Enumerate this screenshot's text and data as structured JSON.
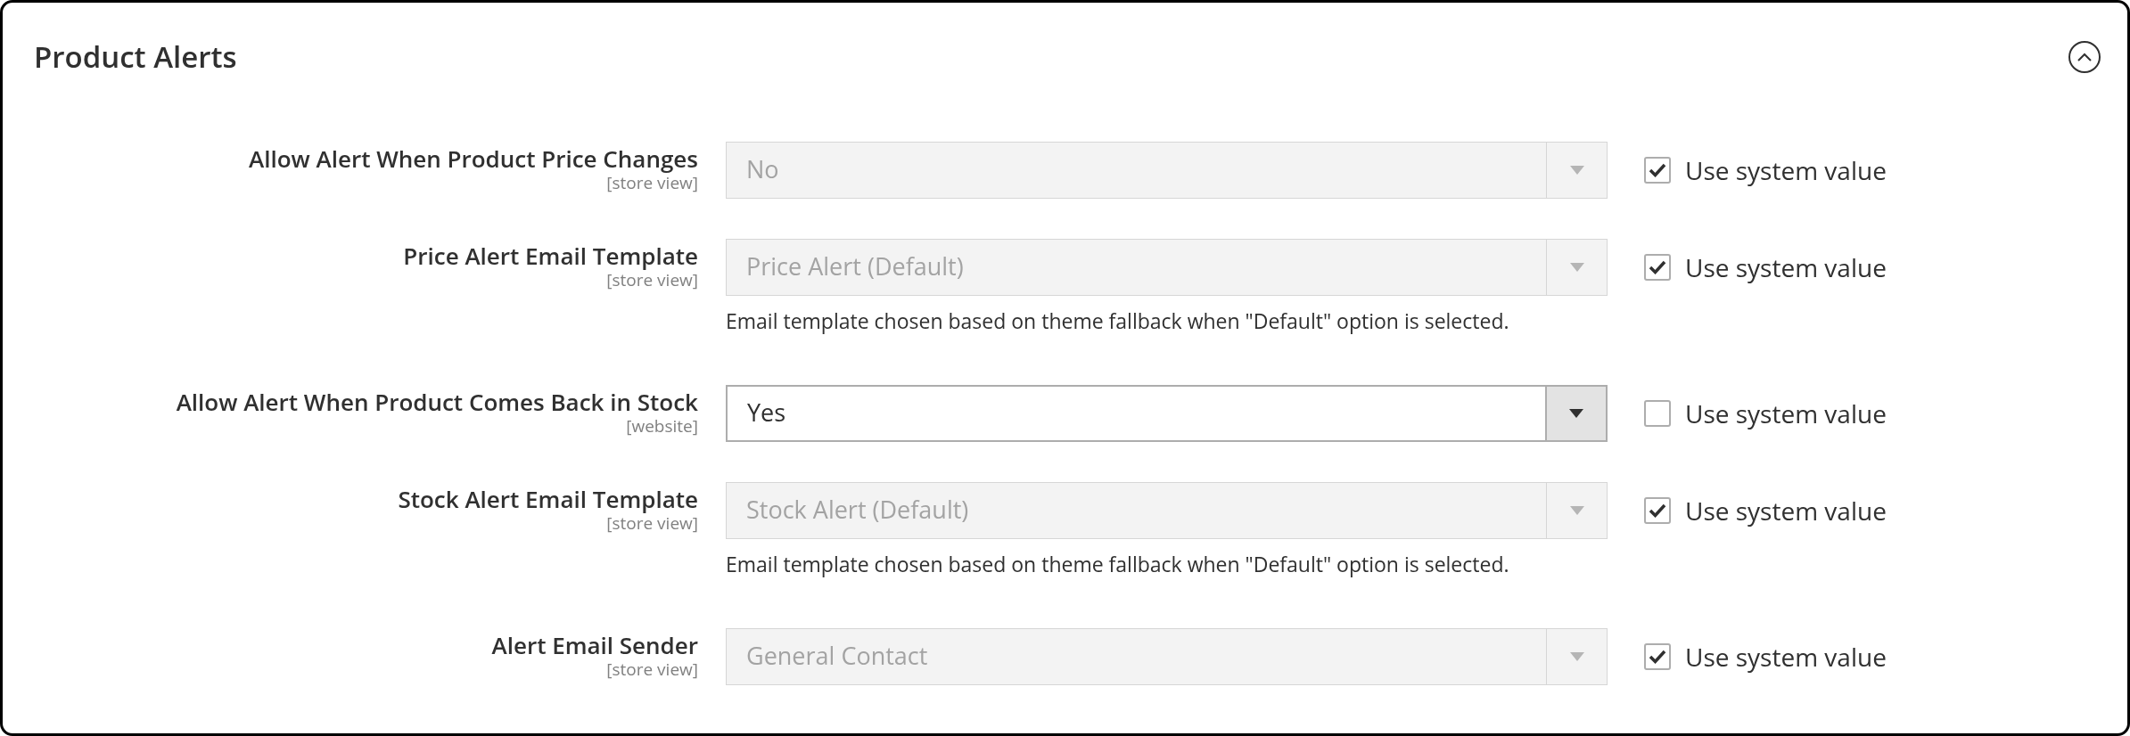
{
  "section": {
    "title": "Product Alerts",
    "expanded": true
  },
  "fields": [
    {
      "label": "Allow Alert When Product Price Changes",
      "scope": "[store view]",
      "value": "No",
      "disabled": true,
      "use_system_value": {
        "label": "Use system value",
        "checked": true
      }
    },
    {
      "label": "Price Alert Email Template",
      "scope": "[store view]",
      "value": "Price Alert (Default)",
      "disabled": true,
      "use_system_value": {
        "label": "Use system value",
        "checked": true
      },
      "note": "Email template chosen based on theme fallback when \"Default\" option is selected."
    },
    {
      "label": "Allow Alert When Product Comes Back in Stock",
      "scope": "[website]",
      "value": "Yes",
      "disabled": false,
      "use_system_value": {
        "label": "Use system value",
        "checked": false
      }
    },
    {
      "label": "Stock Alert Email Template",
      "scope": "[store view]",
      "value": "Stock Alert (Default)",
      "disabled": true,
      "use_system_value": {
        "label": "Use system value",
        "checked": true
      },
      "note": "Email template chosen based on theme fallback when \"Default\" option is selected."
    },
    {
      "label": "Alert Email Sender",
      "scope": "[store view]",
      "value": "General Contact",
      "disabled": true,
      "use_system_value": {
        "label": "Use system value",
        "checked": true
      }
    }
  ]
}
